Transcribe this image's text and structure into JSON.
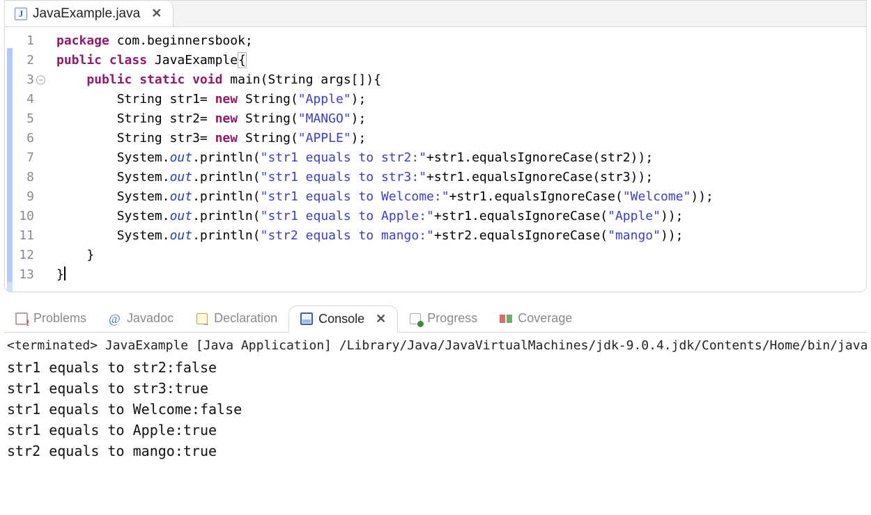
{
  "editor": {
    "tab": {
      "icon_letter": "J",
      "title": "JavaExample.java",
      "close_glyph": "✕"
    },
    "line_numbers": [
      "1",
      "2",
      "3",
      "4",
      "5",
      "6",
      "7",
      "8",
      "9",
      "10",
      "11",
      "12",
      "13"
    ],
    "fold_line_index": 2,
    "highlighted_line_index": 12,
    "code_lines": [
      [
        {
          "t": "package ",
          "c": "kw"
        },
        {
          "t": "com.beginnersbook;"
        }
      ],
      [
        {
          "t": "public class ",
          "c": "kw"
        },
        {
          "t": "JavaExample"
        },
        {
          "t": "{",
          "c": "cursor-box"
        }
      ],
      [
        {
          "t": "    "
        },
        {
          "t": "public static void ",
          "c": "kw"
        },
        {
          "t": "main(String args[]){"
        }
      ],
      [
        {
          "t": "        String str1= "
        },
        {
          "t": "new ",
          "c": "kw"
        },
        {
          "t": "String("
        },
        {
          "t": "\"Apple\"",
          "c": "str"
        },
        {
          "t": ");"
        }
      ],
      [
        {
          "t": "        String str2= "
        },
        {
          "t": "new ",
          "c": "kw"
        },
        {
          "t": "String("
        },
        {
          "t": "\"MANGO\"",
          "c": "str"
        },
        {
          "t": ");"
        }
      ],
      [
        {
          "t": "        String str3= "
        },
        {
          "t": "new ",
          "c": "kw"
        },
        {
          "t": "String("
        },
        {
          "t": "\"APPLE\"",
          "c": "str"
        },
        {
          "t": ");"
        }
      ],
      [
        {
          "t": "        System."
        },
        {
          "t": "out",
          "c": "it"
        },
        {
          "t": ".println("
        },
        {
          "t": "\"str1 equals to str2:\"",
          "c": "str"
        },
        {
          "t": "+str1.equalsIgnoreCase(str2));"
        }
      ],
      [
        {
          "t": "        System."
        },
        {
          "t": "out",
          "c": "it"
        },
        {
          "t": ".println("
        },
        {
          "t": "\"str1 equals to str3:\"",
          "c": "str"
        },
        {
          "t": "+str1.equalsIgnoreCase(str3));"
        }
      ],
      [
        {
          "t": "        System."
        },
        {
          "t": "out",
          "c": "it"
        },
        {
          "t": ".println("
        },
        {
          "t": "\"str1 equals to Welcome:\"",
          "c": "str"
        },
        {
          "t": "+str1.equalsIgnoreCase("
        },
        {
          "t": "\"Welcome\"",
          "c": "str"
        },
        {
          "t": "));"
        }
      ],
      [
        {
          "t": "        System."
        },
        {
          "t": "out",
          "c": "it"
        },
        {
          "t": ".println("
        },
        {
          "t": "\"str1 equals to Apple:\"",
          "c": "str"
        },
        {
          "t": "+str1.equalsIgnoreCase("
        },
        {
          "t": "\"Apple\"",
          "c": "str"
        },
        {
          "t": "));"
        }
      ],
      [
        {
          "t": "        System."
        },
        {
          "t": "out",
          "c": "it"
        },
        {
          "t": ".println("
        },
        {
          "t": "\"str2 equals to mango:\"",
          "c": "str"
        },
        {
          "t": "+str2.equalsIgnoreCase("
        },
        {
          "t": "\"mango\"",
          "c": "str"
        },
        {
          "t": "));"
        }
      ],
      [
        {
          "t": "    }"
        }
      ],
      [
        {
          "t": "}"
        },
        {
          "t": "",
          "c": "caret"
        }
      ]
    ]
  },
  "views": {
    "tabs": [
      {
        "id": "problems",
        "label": "Problems",
        "icon": "ico-problems",
        "active": false
      },
      {
        "id": "javadoc",
        "label": "Javadoc",
        "icon": "ico-javadoc",
        "active": false,
        "icon_text": "@"
      },
      {
        "id": "declaration",
        "label": "Declaration",
        "icon": "ico-decl",
        "active": false
      },
      {
        "id": "console",
        "label": "Console",
        "icon": "ico-console",
        "active": true,
        "closable": true,
        "close_glyph": "✕"
      },
      {
        "id": "progress",
        "label": "Progress",
        "icon": "ico-progress",
        "active": false
      },
      {
        "id": "coverage",
        "label": "Coverage",
        "icon": "ico-coverage",
        "active": false
      }
    ],
    "status_line": "<terminated> JavaExample [Java Application] /Library/Java/JavaVirtualMachines/jdk-9.0.4.jdk/Contents/Home/bin/java",
    "console_output": [
      "str1 equals to str2:false",
      "str1 equals to str3:true",
      "str1 equals to Welcome:false",
      "str1 equals to Apple:true",
      "str2 equals to mango:true"
    ]
  }
}
